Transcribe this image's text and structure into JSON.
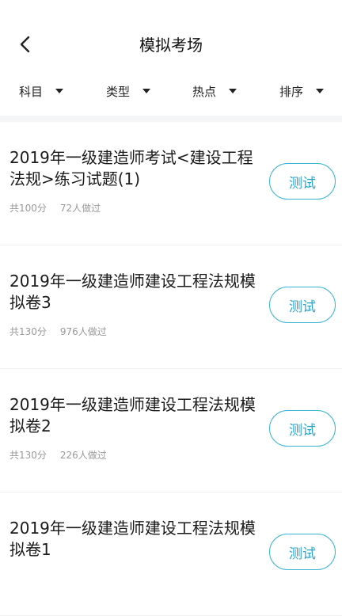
{
  "header": {
    "title": "模拟考场"
  },
  "filters": [
    {
      "label": "科目"
    },
    {
      "label": "类型"
    },
    {
      "label": "热点"
    },
    {
      "label": "排序"
    }
  ],
  "exams": [
    {
      "title": "2019年一级建造师考试<建设工程法规>练习试题(1)",
      "score": "共100分",
      "taken": "72人做过",
      "button": "测试"
    },
    {
      "title": "2019年一级建造师建设工程法规模拟卷3",
      "score": "共130分",
      "taken": "976人做过",
      "button": "测试"
    },
    {
      "title": "2019年一级建造师建设工程法规模拟卷2",
      "score": "共130分",
      "taken": "226人做过",
      "button": "测试"
    },
    {
      "title": "2019年一级建造师建设工程法规模拟卷1",
      "score": "",
      "taken": "",
      "button": "测试"
    }
  ],
  "colors": {
    "accent": "#2aa4c9",
    "accent_border": "#3bb4d6",
    "meta_text": "#999999",
    "divider": "#f5f6f7"
  },
  "icons": {
    "back": "chevron-left-icon",
    "dropdown": "caret-down-icon"
  }
}
